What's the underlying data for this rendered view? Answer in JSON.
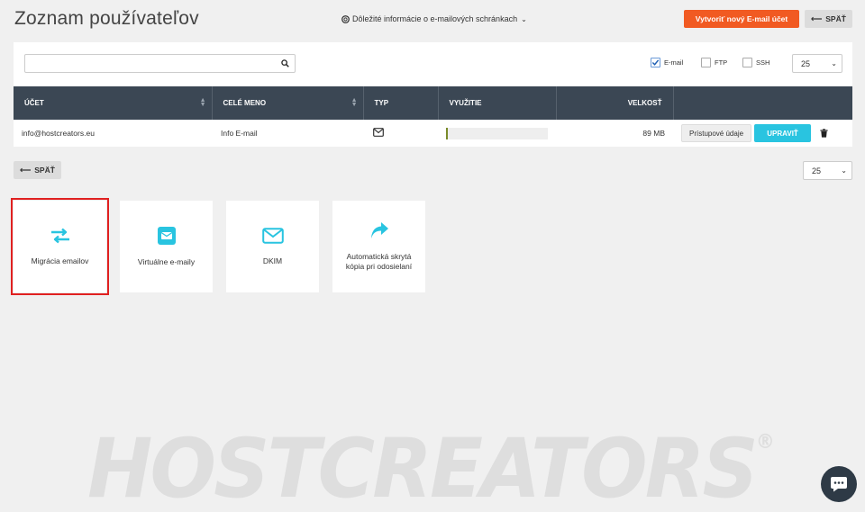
{
  "header": {
    "title": "Zoznam používateľov",
    "info_link": "Dôležité informácie o e-mailových schránkach",
    "create_button": "Vytvoriť nový E-mail účet",
    "back_button": "SPÄŤ"
  },
  "filters": {
    "search": {
      "value": "",
      "placeholder": ""
    },
    "email_label": "E-mail",
    "email_checked": true,
    "ftp_label": "FTP",
    "ftp_checked": false,
    "ssh_label": "SSH",
    "ssh_checked": false,
    "per_page": "25"
  },
  "table": {
    "columns": [
      "ÚČET",
      "CELÉ MENO",
      "TYP",
      "VYUŽITIE",
      "VELKOSŤ",
      ""
    ],
    "rows": [
      {
        "account": "info@hostcreators.eu",
        "full_name": "Info E-mail",
        "type_icon": "envelope-icon",
        "usage_fraction": 0.01,
        "size": "89 MB",
        "access_button": "Prístupové údaje",
        "edit_button": "UPRAVIŤ"
      }
    ]
  },
  "footer": {
    "back_button": "SPÄŤ",
    "per_page": "25"
  },
  "tiles": [
    {
      "label": "Migrácia emailov",
      "icon": "transfer-arrows-icon"
    },
    {
      "label": "Virtuálne e-maily",
      "icon": "envelope-square-icon"
    },
    {
      "label": "DKIM",
      "icon": "envelope-outline-icon"
    },
    {
      "label": "Automatická skrytá kópia pri odosielaní",
      "icon": "share-arrow-icon"
    }
  ],
  "watermark": "HOSTCREATORS",
  "colors": {
    "accent_orange": "#f15a22",
    "accent_cyan": "#29c4e0",
    "table_header": "#3b4754",
    "selection_red": "#e02020"
  }
}
